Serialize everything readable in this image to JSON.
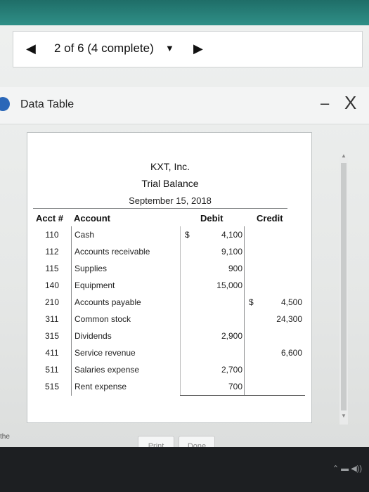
{
  "nav": {
    "prev_label": "◀",
    "next_label": "▶",
    "position": "2 of 6 (4 complete)",
    "dropdown_label": "▼"
  },
  "dialog": {
    "title": "Data Table",
    "minimize_label": "–",
    "close_label": "X"
  },
  "statement": {
    "company": "KXT, Inc.",
    "report": "Trial Balance",
    "date": "September 15, 2018"
  },
  "columns": {
    "acct": "Acct #",
    "account": "Account",
    "debit": "Debit",
    "credit": "Credit"
  },
  "rows": [
    {
      "acct": "110",
      "account": "Cash",
      "debit_symbol": "$",
      "debit": "4,100",
      "credit_symbol": "",
      "credit": ""
    },
    {
      "acct": "112",
      "account": "Accounts receivable",
      "debit_symbol": "",
      "debit": "9,100",
      "credit_symbol": "",
      "credit": ""
    },
    {
      "acct": "115",
      "account": "Supplies",
      "debit_symbol": "",
      "debit": "900",
      "credit_symbol": "",
      "credit": ""
    },
    {
      "acct": "140",
      "account": "Equipment",
      "debit_symbol": "",
      "debit": "15,000",
      "credit_symbol": "",
      "credit": ""
    },
    {
      "acct": "210",
      "account": "Accounts payable",
      "debit_symbol": "",
      "debit": "",
      "credit_symbol": "$",
      "credit": "4,500"
    },
    {
      "acct": "311",
      "account": "Common stock",
      "debit_symbol": "",
      "debit": "",
      "credit_symbol": "",
      "credit": "24,300"
    },
    {
      "acct": "315",
      "account": "Dividends",
      "debit_symbol": "",
      "debit": "2,900",
      "credit_symbol": "",
      "credit": ""
    },
    {
      "acct": "411",
      "account": "Service revenue",
      "debit_symbol": "",
      "debit": "",
      "credit_symbol": "",
      "credit": "6,600"
    },
    {
      "acct": "511",
      "account": "Salaries expense",
      "debit_symbol": "",
      "debit": "2,700",
      "credit_symbol": "",
      "credit": ""
    },
    {
      "acct": "515",
      "account": "Rent expense",
      "debit_symbol": "",
      "debit": "700",
      "credit_symbol": "",
      "credit": ""
    }
  ],
  "buttons": {
    "print": "Print",
    "done": "Done"
  },
  "side_text": "the",
  "icons": [
    "info-icon",
    "minimize-icon",
    "close-icon",
    "scroll-up-icon",
    "scroll-down-icon"
  ]
}
